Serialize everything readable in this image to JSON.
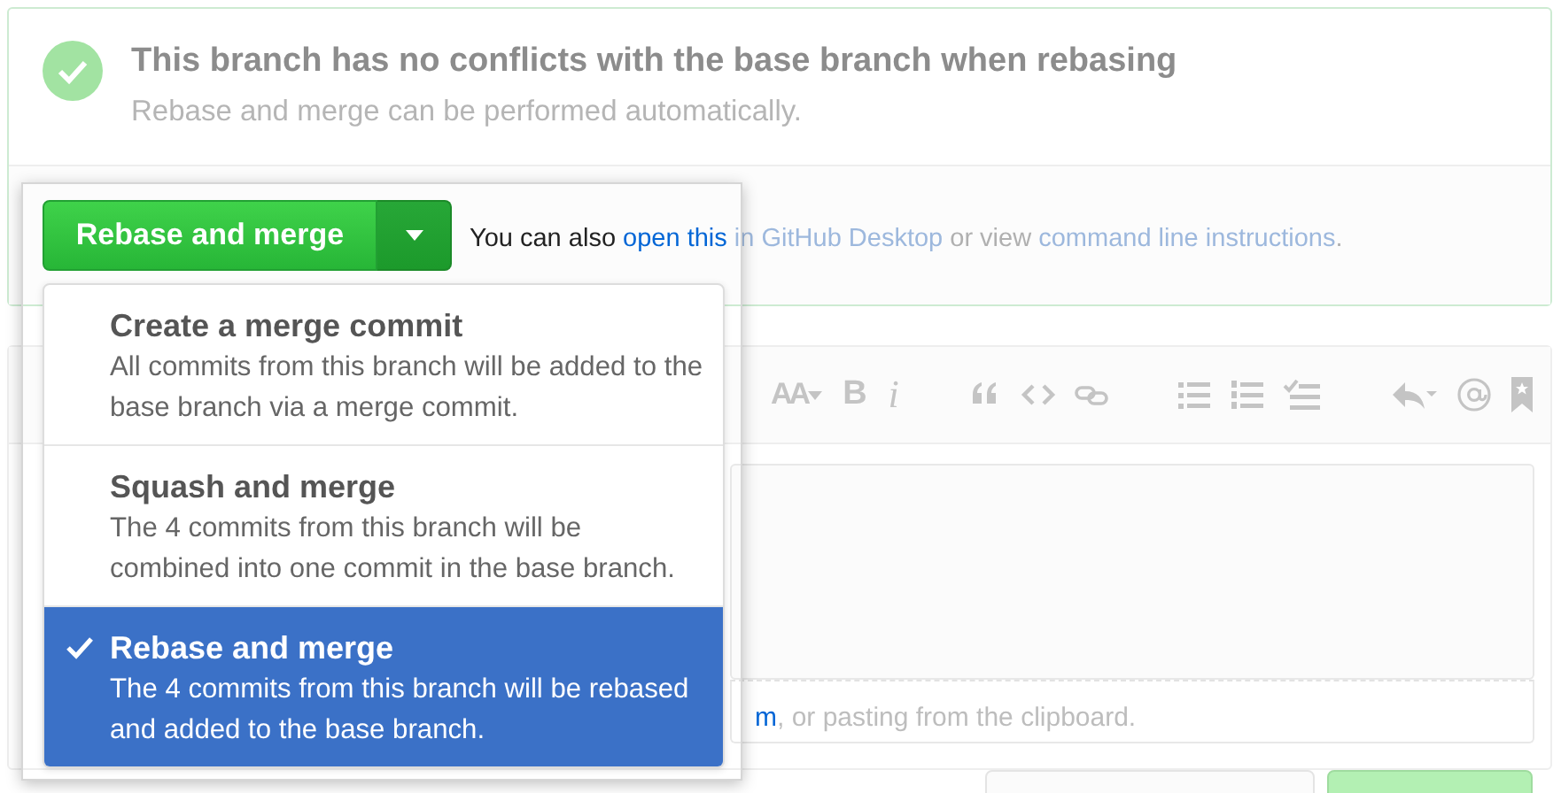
{
  "merge_status": {
    "ok": true,
    "title": "This branch has no conflicts with the base branch when rebasing",
    "subtitle": "Rebase and merge can be performed automatically."
  },
  "merge_button": {
    "label": "Rebase and merge"
  },
  "alt_text": {
    "before": "You can also ",
    "link_1": "open this in GitHub Desktop",
    "middle": " or view ",
    "link_2": "command line instructions",
    "after": "."
  },
  "merge_menu": [
    {
      "title": "Create a merge commit",
      "description": "All commits from this branch will be added to the base branch via a merge commit.",
      "selected": false
    },
    {
      "title": "Squash and merge",
      "description": "The 4 commits from this branch will be combined into one commit in the base branch.",
      "selected": false
    },
    {
      "title": "Rebase and merge",
      "description": "The 4 commits from this branch will be rebased and added to the base branch.",
      "selected": true
    }
  ],
  "toolbar": [
    {
      "kind": "text-menu",
      "text": "AA"
    },
    {
      "kind": "text",
      "text": "B"
    },
    {
      "kind": "italic",
      "text": "i"
    },
    {
      "kind": "gap"
    },
    {
      "kind": "quote"
    },
    {
      "kind": "code"
    },
    {
      "kind": "link"
    },
    {
      "kind": "gap"
    },
    {
      "kind": "bullets"
    },
    {
      "kind": "numbers"
    },
    {
      "kind": "tasks"
    },
    {
      "kind": "gap"
    },
    {
      "kind": "reply"
    },
    {
      "kind": "mention"
    },
    {
      "kind": "bookmark"
    }
  ],
  "comment_footer": {
    "link": "m",
    "text": ", or pasting from the clipboard."
  }
}
